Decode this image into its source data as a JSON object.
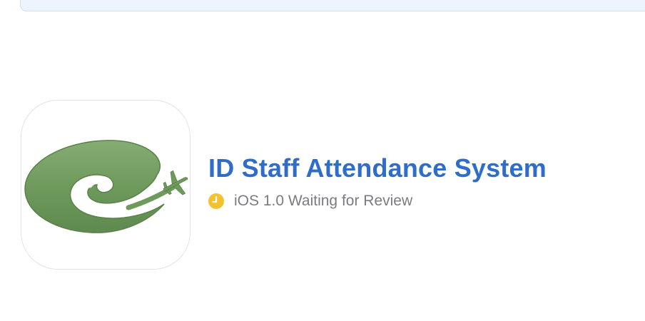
{
  "app": {
    "name": "ID Staff Attendance System",
    "status": {
      "icon": "clock-icon",
      "icon_color": "#f2c231",
      "text": "iOS 1.0 Waiting for Review"
    },
    "icon": {
      "name": "app-icon-green-spiral-airplane",
      "color": "#6e9a5c"
    }
  },
  "colors": {
    "title": "#2f6dc8",
    "status_text": "#7b7b80",
    "banner_bg": "#eef4fd",
    "banner_border": "#cddff6"
  }
}
